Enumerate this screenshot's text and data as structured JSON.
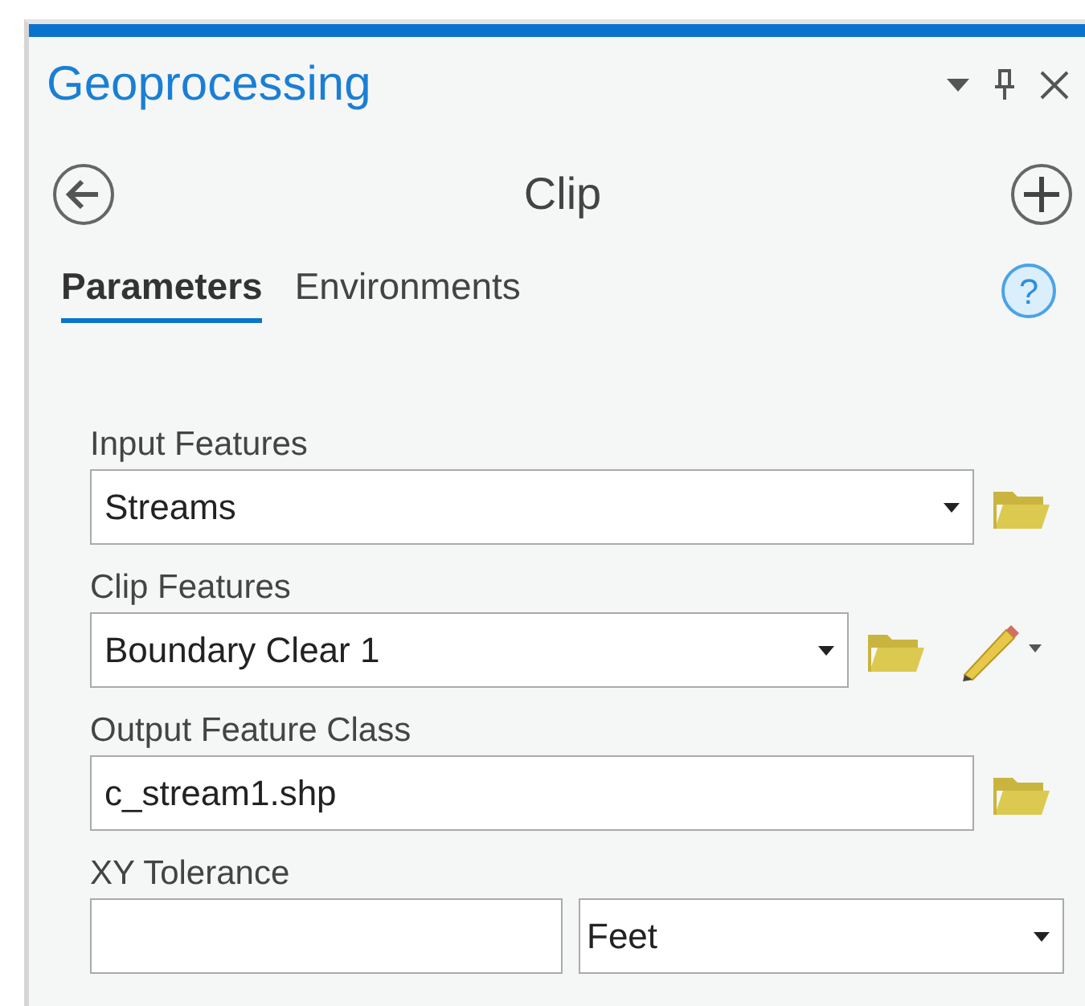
{
  "panel": {
    "title": "Geoprocessing"
  },
  "tool": {
    "title": "Clip"
  },
  "help": {
    "symbol": "?"
  },
  "tabs": [
    {
      "label": "Parameters",
      "selected": true
    },
    {
      "label": "Environments",
      "selected": false
    }
  ],
  "parameters": [
    {
      "label": "Input Features",
      "kind": "dropdown",
      "value": "Streams",
      "actions": [
        {
          "kind": "folder"
        }
      ]
    },
    {
      "label": "Clip Features",
      "kind": "dropdown",
      "value": "Boundary Clear 1",
      "actions": [
        {
          "kind": "folder"
        },
        {
          "kind": "pencil"
        }
      ]
    },
    {
      "label": "Output Feature Class",
      "kind": "text",
      "value": "c_stream1.shp",
      "actions": [
        {
          "kind": "folder"
        }
      ]
    },
    {
      "label": "XY Tolerance",
      "kind": "tolerance",
      "unit": "Feet"
    }
  ]
}
